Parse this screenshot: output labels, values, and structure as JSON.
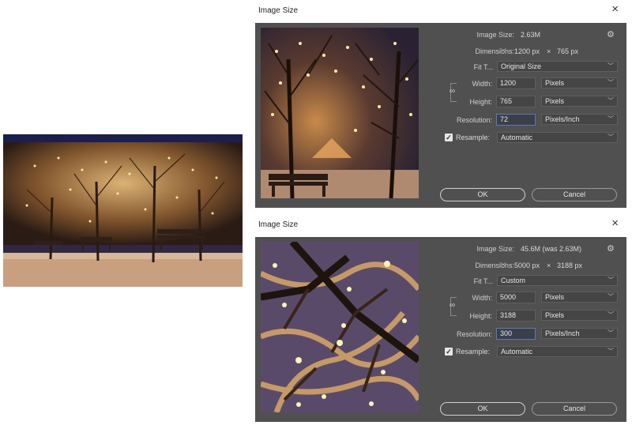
{
  "dialogs": [
    {
      "title": "Image Size",
      "close_icon": "×",
      "image_size_label": "Image Size:",
      "image_size_value": "2.63M",
      "dimensions_label": "Dimensions:",
      "dimensions_width": "1200 px",
      "dimensions_x": "×",
      "dimensions_height": "765 px",
      "fit_label": "Fit T...",
      "fit_value": "Original Size",
      "width_label": "Width:",
      "width_value": "1200",
      "width_unit": "Pixels",
      "height_label": "Height:",
      "height_value": "765",
      "height_unit": "Pixels",
      "resolution_label": "Resolution:",
      "resolution_value": "72",
      "resolution_unit": "Pixels/Inch",
      "resample_label": "Resample:",
      "resample_value": "Automatic",
      "resample_checked": true,
      "ok_label": "OK",
      "cancel_label": "Cancel"
    },
    {
      "title": "Image Size",
      "close_icon": "×",
      "image_size_label": "Image Size:",
      "image_size_value": "45.6M (was 2.63M)",
      "dimensions_label": "Dimensions:",
      "dimensions_width": "5000 px",
      "dimensions_x": "×",
      "dimensions_height": "3188 px",
      "fit_label": "Fit T...",
      "fit_value": "Custom",
      "width_label": "Width:",
      "width_value": "5000",
      "width_unit": "Pixels",
      "height_label": "Height:",
      "height_value": "3188",
      "height_unit": "Pixels",
      "resolution_label": "Resolution:",
      "resolution_value": "300",
      "resolution_unit": "Pixels/Inch",
      "resample_label": "Resample:",
      "resample_value": "Automatic",
      "resample_checked": true,
      "ok_label": "OK",
      "cancel_label": "Cancel"
    }
  ],
  "icons": {
    "gear": "gear-icon",
    "chevron": "chevron-down-icon",
    "link": "link-icon",
    "check": "checkmark-icon",
    "close": "close-icon"
  },
  "colors": {
    "dialog_bg": "#505050",
    "field_bg": "#454545",
    "active_field_border": "#5a7bb5",
    "light_warm": "#f6d27a"
  }
}
